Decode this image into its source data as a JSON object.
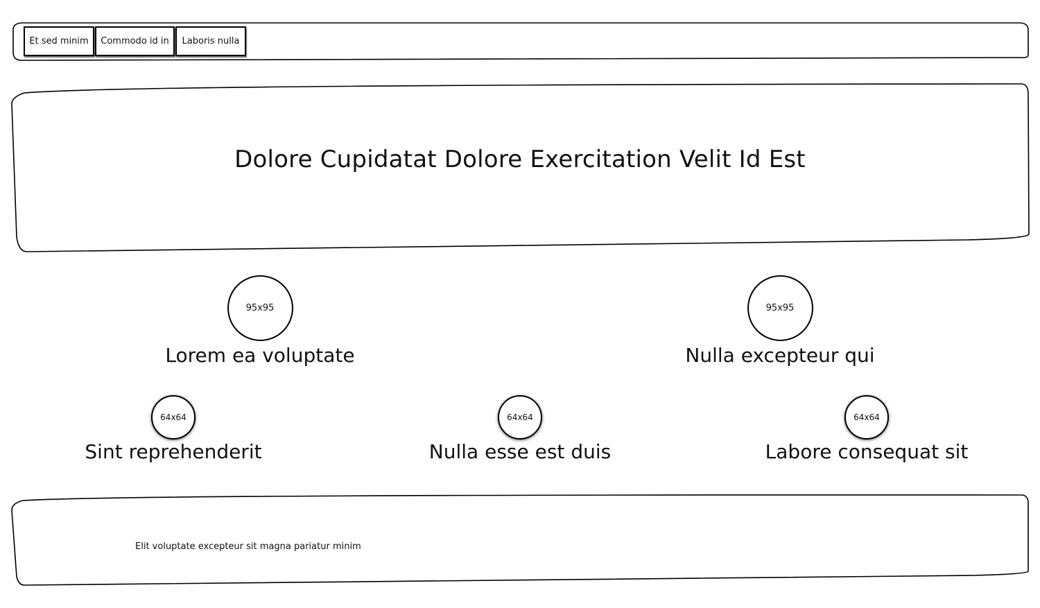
{
  "navbar": {
    "tabs": [
      {
        "label": "Et sed minim"
      },
      {
        "label": "Commodo id in"
      },
      {
        "label": "Laboris nulla"
      }
    ]
  },
  "hero": {
    "title": "Dolore Cupidatat Dolore Exercitation Velit Id Est"
  },
  "features": [
    {
      "image_label": "95x95",
      "label": "Lorem ea voluptate"
    },
    {
      "image_label": "95x95",
      "label": "Nulla excepteur qui"
    },
    {
      "image_label": "64x64",
      "label": "Sint reprehenderit"
    },
    {
      "image_label": "64x64",
      "label": "Nulla esse est duis"
    },
    {
      "image_label": "64x64",
      "label": "Labore consequat sit"
    }
  ],
  "footer": {
    "text": "Elit voluptate excepteur sit magna pariatur minim"
  }
}
